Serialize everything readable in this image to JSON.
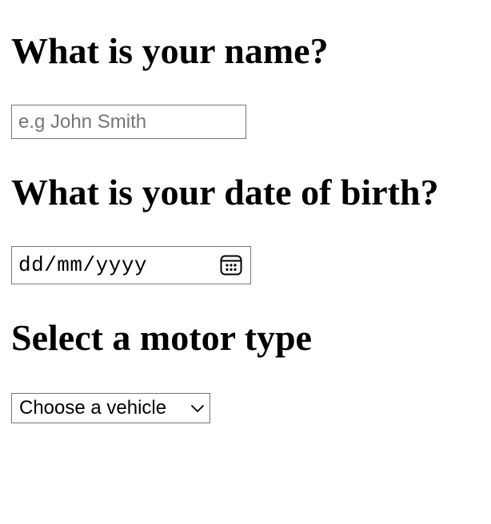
{
  "form": {
    "name_question": "What is your name?",
    "name_placeholder": "e.g John Smith",
    "name_value": "",
    "dob_question": "What is your date of birth?",
    "dob_display": "dd/mm/yyyy",
    "motor_question": "Select a motor type",
    "motor_selected": "Choose a vehicle"
  },
  "icons": {
    "date_picker": "calendar-icon",
    "select_dropdown": "chevron-down-icon"
  }
}
